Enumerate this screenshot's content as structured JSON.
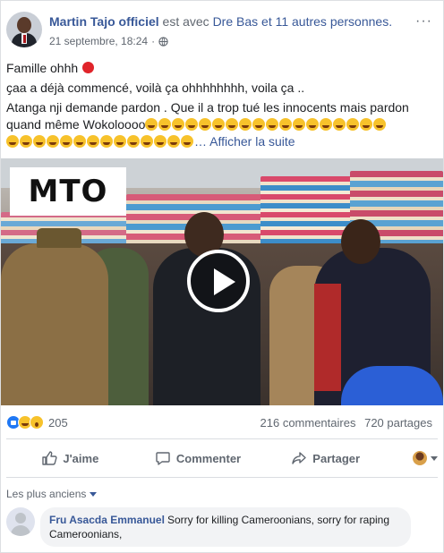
{
  "post": {
    "author": "Martin Tajo officiel",
    "with_text": "est avec",
    "with_name": "Dre Bas",
    "with_others": "et 11 autres personnes.",
    "timestamp": "21 septembre, 18:24",
    "separator": "·",
    "privacy_icon": "globe-icon",
    "more_label": "···",
    "line1": "Famille ohhh",
    "line2": "ҫaa a déjà commencé, voilà ça ohhhhhhhh, voila ça ..",
    "line3": "Atanga nji demande pardon . Que il a trop tué les innocents mais pardon",
    "line4": "quand même Wokoloooo",
    "see_more": "… Afficher la suite",
    "emoji_icon": "laughing-face-emoji",
    "emoji_count_line4": 18,
    "emoji_count_line5": 14
  },
  "video": {
    "logo": "MTO",
    "play_icon": "play-icon"
  },
  "stats": {
    "reactions": [
      "like",
      "haha",
      "wow"
    ],
    "reaction_count": "205",
    "comments": "216 commentaires",
    "shares": "720 partages"
  },
  "actions": {
    "like": "J'aime",
    "comment": "Commenter",
    "share": "Partager"
  },
  "comments": {
    "sort_label": "Les plus anciens",
    "items": [
      {
        "author": "Fru Asacda Emmanuel",
        "text": "Sorry for killing Cameroonians, sorry for raping Cameroonians,"
      }
    ]
  },
  "colors": {
    "link": "#385898",
    "muted": "#606770",
    "like_blue": "#2078f4",
    "divider": "#dadde1"
  }
}
